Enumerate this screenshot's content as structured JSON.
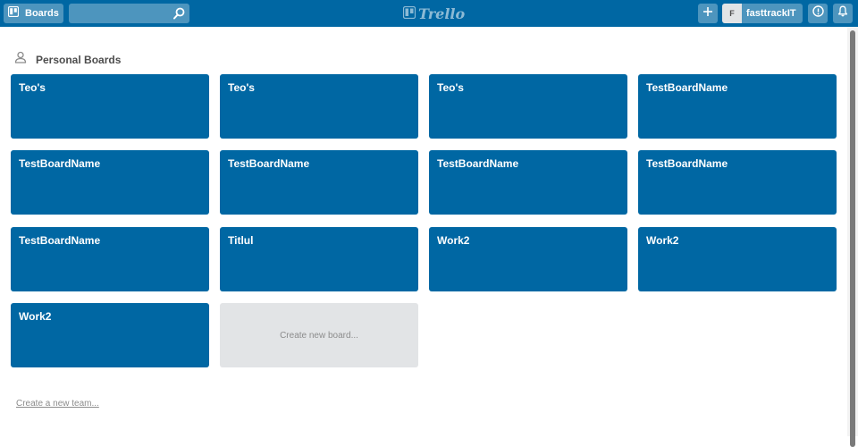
{
  "header": {
    "boards_label": "Boards",
    "search_value": "",
    "logo_text": "Trello",
    "avatar_initial": "F",
    "username": "fasttrackIT"
  },
  "section": {
    "title": "Personal Boards"
  },
  "boards": [
    {
      "name": "Teo's"
    },
    {
      "name": "Teo's"
    },
    {
      "name": "Teo's"
    },
    {
      "name": "TestBoardName"
    },
    {
      "name": "TestBoardName"
    },
    {
      "name": "TestBoardName"
    },
    {
      "name": "TestBoardName"
    },
    {
      "name": "TestBoardName"
    },
    {
      "name": "TestBoardName"
    },
    {
      "name": "Titlul"
    },
    {
      "name": "Work2"
    },
    {
      "name": "Work2"
    },
    {
      "name": "Work2"
    }
  ],
  "create_board_label": "Create new board...",
  "create_team_label": "Create a new team...",
  "colors": {
    "header": "#0067a3",
    "board_tile": "#0067a3",
    "create_tile": "#e2e4e6"
  },
  "icons": {
    "boards": "boards-icon",
    "search": "search-icon",
    "logo": "trello-logo-icon",
    "add": "plus-icon",
    "info": "info-icon",
    "notifications": "bell-icon",
    "section": "person-icon"
  }
}
